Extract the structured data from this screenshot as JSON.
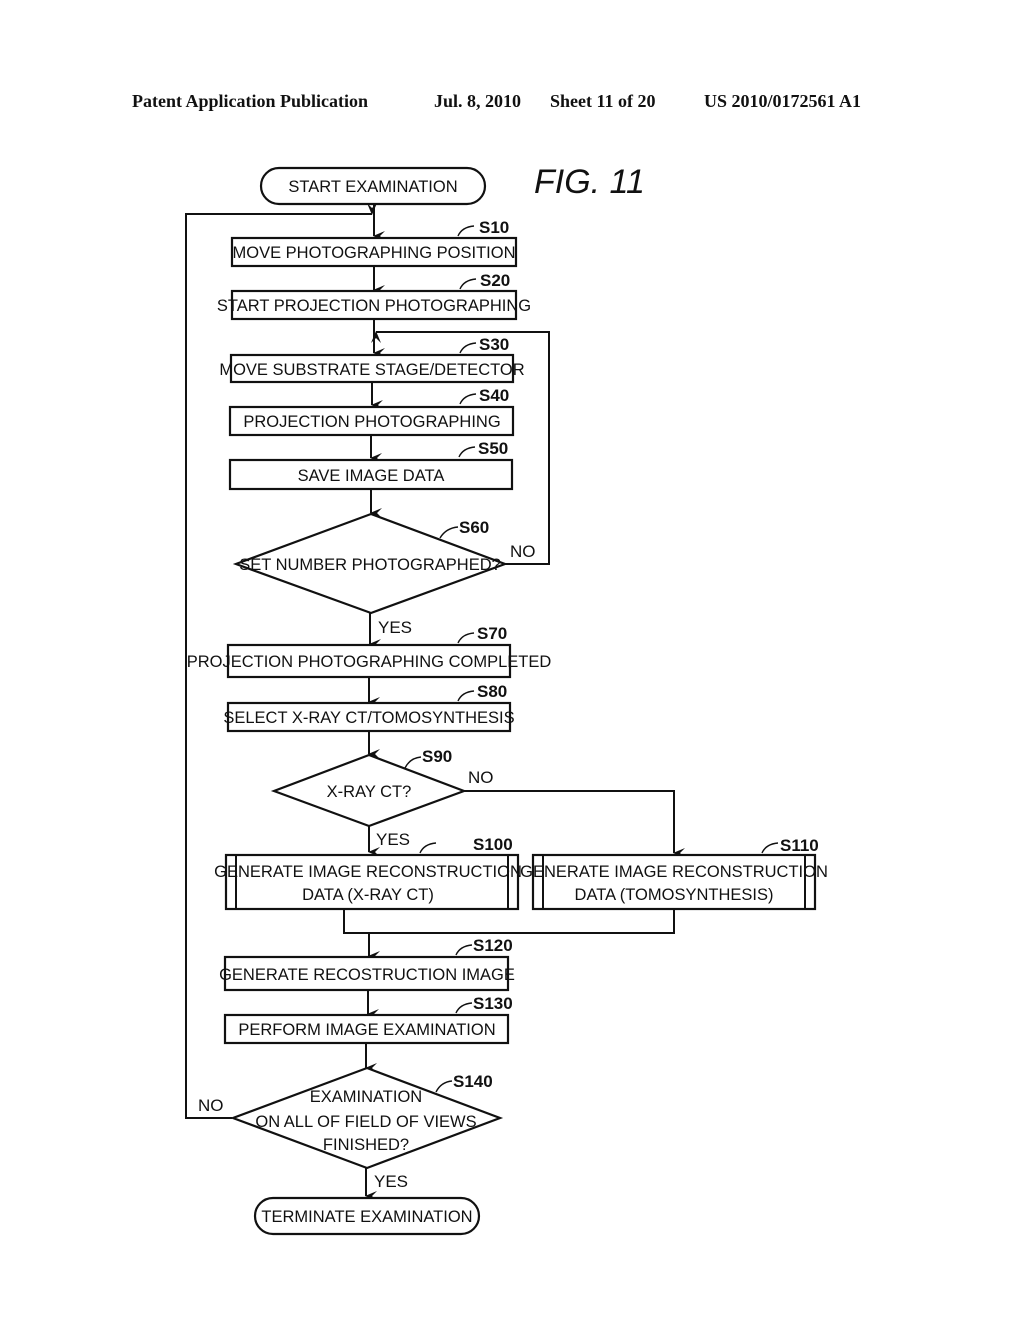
{
  "header": {
    "publication": "Patent Application Publication",
    "date": "Jul. 8, 2010",
    "sheet": "Sheet 11 of 20",
    "number": "US 2010/0172561 A1"
  },
  "figure": {
    "label": "FIG. 11"
  },
  "flowchart": {
    "start": "START EXAMINATION",
    "end": "TERMINATE EXAMINATION",
    "steps": {
      "s10": {
        "id": "S10",
        "text": "MOVE PHOTOGRAPHING POSITION"
      },
      "s20": {
        "id": "S20",
        "text": "START PROJECTION PHOTOGRAPHING"
      },
      "s30": {
        "id": "S30",
        "text": "MOVE SUBSTRATE STAGE/DETECTOR"
      },
      "s40": {
        "id": "S40",
        "text": "PROJECTION PHOTOGRAPHING"
      },
      "s50": {
        "id": "S50",
        "text": "SAVE IMAGE DATA"
      },
      "s60": {
        "id": "S60",
        "text": "SET NUMBER PHOTOGRAPHED?",
        "yes": "YES",
        "no": "NO"
      },
      "s70": {
        "id": "S70",
        "text": "PROJECTION PHOTOGRAPHING COMPLETED"
      },
      "s80": {
        "id": "S80",
        "text": "SELECT X-RAY CT/TOMOSYNTHESIS"
      },
      "s90": {
        "id": "S90",
        "text": "X-RAY CT?",
        "yes": "YES",
        "no": "NO"
      },
      "s100": {
        "id": "S100",
        "line1": "GENERATE IMAGE RECONSTRUCTION",
        "line2": "DATA (X-RAY CT)"
      },
      "s110": {
        "id": "S110",
        "line1": "GENERATE IMAGE RECONSTRUCTION",
        "line2": "DATA (TOMOSYNTHESIS)"
      },
      "s120": {
        "id": "S120",
        "text": "GENERATE RECOSTRUCTION IMAGE"
      },
      "s130": {
        "id": "S130",
        "text": "PERFORM IMAGE EXAMINATION"
      },
      "s140": {
        "id": "S140",
        "line1": "EXAMINATION",
        "line2": "ON ALL OF FIELD OF VIEWS",
        "line3": "FINISHED?",
        "yes": "YES",
        "no": "NO"
      }
    }
  }
}
